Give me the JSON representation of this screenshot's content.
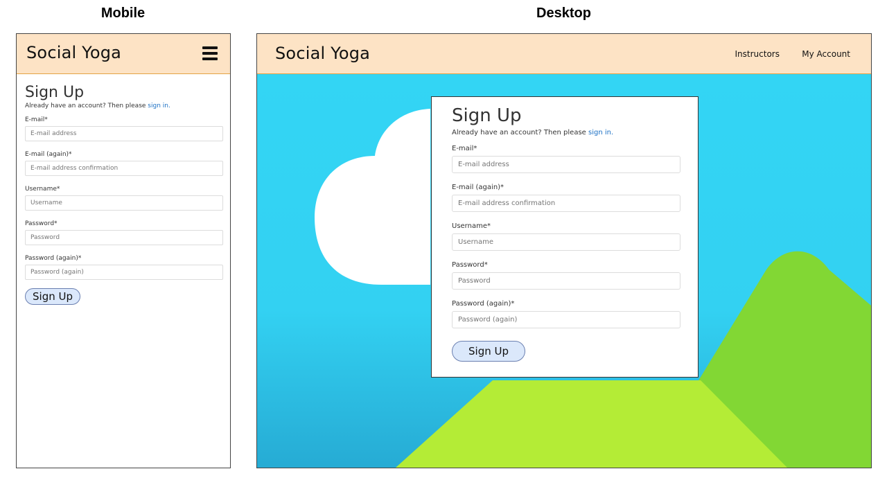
{
  "captions": {
    "mobile": "Mobile",
    "desktop": "Desktop"
  },
  "brand": "Social Yoga",
  "nav": {
    "instructors": "Instructors",
    "account": "My Account"
  },
  "form": {
    "title": "Sign Up",
    "hint_prefix": "Already have an account? Then please ",
    "hint_link": "sign in.",
    "fields": [
      {
        "label": "E-mail*",
        "placeholder": "E-mail address"
      },
      {
        "label": "E-mail (again)*",
        "placeholder": "E-mail address confirmation"
      },
      {
        "label": "Username*",
        "placeholder": "Username"
      },
      {
        "label": "Password*",
        "placeholder": "Password"
      },
      {
        "label": "Password (again)*",
        "placeholder": "Password (again)"
      }
    ],
    "submit_label": "Sign Up"
  },
  "colors": {
    "navbar": "#fde3c5",
    "sky": "#33d5f4",
    "hill_green": "#82d734",
    "hill_lime": "#b4ec36",
    "button": "#dbe8fb"
  },
  "icons": {
    "menu": "hamburger-icon"
  }
}
